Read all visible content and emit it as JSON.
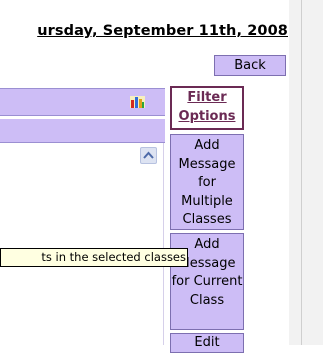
{
  "header": {
    "date_text": "ursday, September 11th, 2008"
  },
  "nav": {
    "back_label": "Back"
  },
  "sidebar": {
    "filter_label_line1": "Filter",
    "filter_label_line2": "Options",
    "buttons": [
      {
        "lines": [
          "Add",
          "Message",
          "for Multiple",
          "Classes"
        ]
      },
      {
        "lines": [
          "Add",
          "Message",
          "for Current",
          "Class"
        ]
      },
      {
        "lines": [
          "Edit"
        ]
      }
    ]
  },
  "tooltip": {
    "text": "ts in the selected classes"
  },
  "icons": {
    "chart": "bar-chart-icon",
    "scroll": "scroll-up-icon"
  },
  "colors": {
    "accent": "#cdbdf6",
    "link": "#6b2a54",
    "tooltip_bg": "#ffffe1"
  }
}
